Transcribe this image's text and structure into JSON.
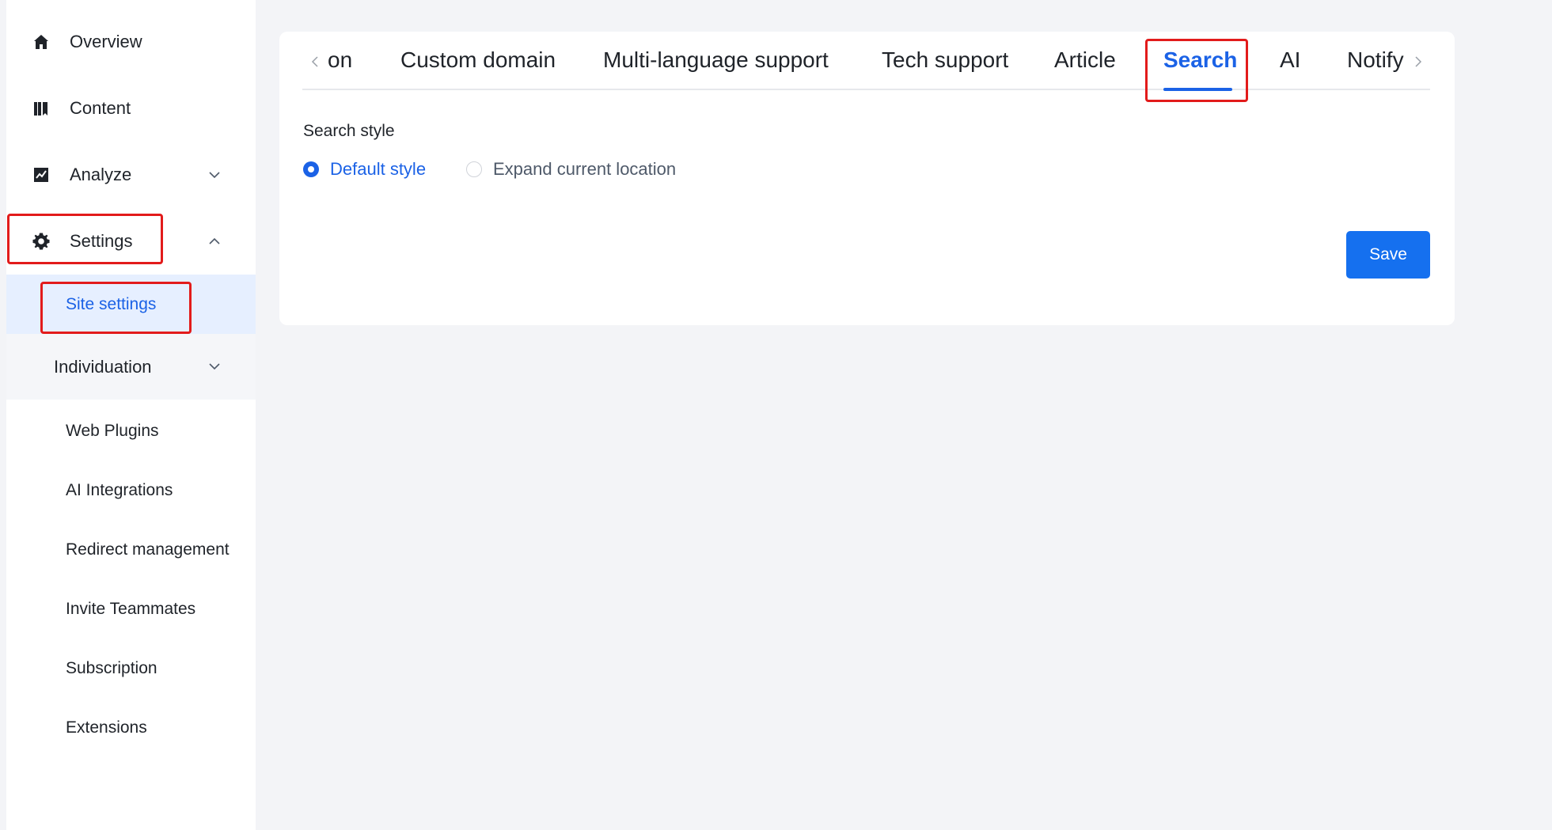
{
  "sidebar": {
    "items": [
      {
        "label": "Overview",
        "icon": "home-icon"
      },
      {
        "label": "Content",
        "icon": "book-icon"
      },
      {
        "label": "Analyze",
        "icon": "chart-icon"
      },
      {
        "label": "Settings",
        "icon": "gear-icon"
      }
    ],
    "sub_items": [
      {
        "label": "Site settings"
      },
      {
        "label": "Individuation"
      },
      {
        "label": "Web Plugins"
      },
      {
        "label": "AI Integrations"
      },
      {
        "label": "Redirect management"
      },
      {
        "label": "Invite Teammates"
      },
      {
        "label": "Subscription"
      },
      {
        "label": "Extensions"
      }
    ]
  },
  "tabs": {
    "items": [
      {
        "label": "on"
      },
      {
        "label": "Custom domain"
      },
      {
        "label": "Multi-language support"
      },
      {
        "label": "Tech support"
      },
      {
        "label": "Article"
      },
      {
        "label": "Search"
      },
      {
        "label": "AI"
      },
      {
        "label": "Notify"
      }
    ],
    "active": "Search"
  },
  "search": {
    "section_label": "Search style",
    "options": [
      {
        "label": "Default style",
        "checked": true
      },
      {
        "label": "Expand current location",
        "checked": false
      }
    ],
    "save_label": "Save"
  },
  "colors": {
    "accent": "#1b62e6",
    "button": "#1570ef",
    "highlight": "#e21b1b",
    "active_bg": "#e6efff"
  }
}
